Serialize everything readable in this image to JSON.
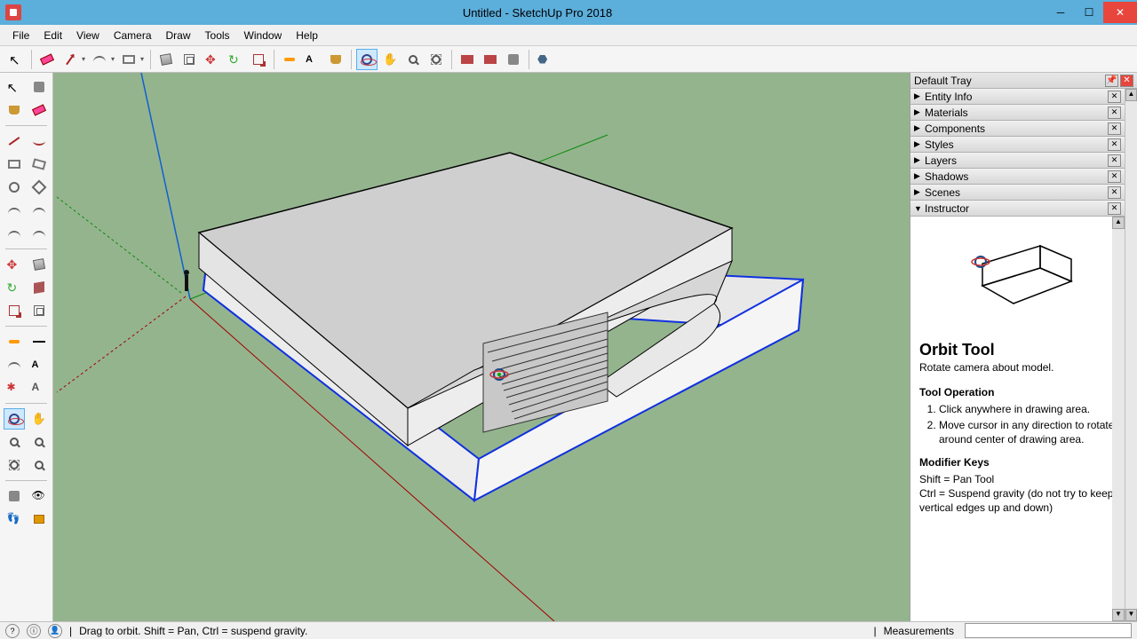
{
  "window": {
    "title": "Untitled - SketchUp Pro 2018"
  },
  "menu": {
    "items": [
      "File",
      "Edit",
      "View",
      "Camera",
      "Draw",
      "Tools",
      "Window",
      "Help"
    ]
  },
  "tray": {
    "title": "Default Tray",
    "panels": [
      "Entity Info",
      "Materials",
      "Components",
      "Styles",
      "Layers",
      "Shadows",
      "Scenes",
      "Instructor"
    ]
  },
  "instructor": {
    "title": "Orbit Tool",
    "subtitle": "Rotate camera about model.",
    "operation_heading": "Tool Operation",
    "steps": [
      "Click anywhere in drawing area.",
      "Move cursor in any direction to rotate around center of drawing area."
    ],
    "modifiers_heading": "Modifier Keys",
    "modifiers": [
      "Shift = Pan Tool",
      "Ctrl = Suspend gravity (do not try to keep vertical edges up and down)"
    ]
  },
  "status": {
    "hint": "Drag to orbit. Shift = Pan, Ctrl = suspend gravity.",
    "measurements_label": "Measurements"
  }
}
